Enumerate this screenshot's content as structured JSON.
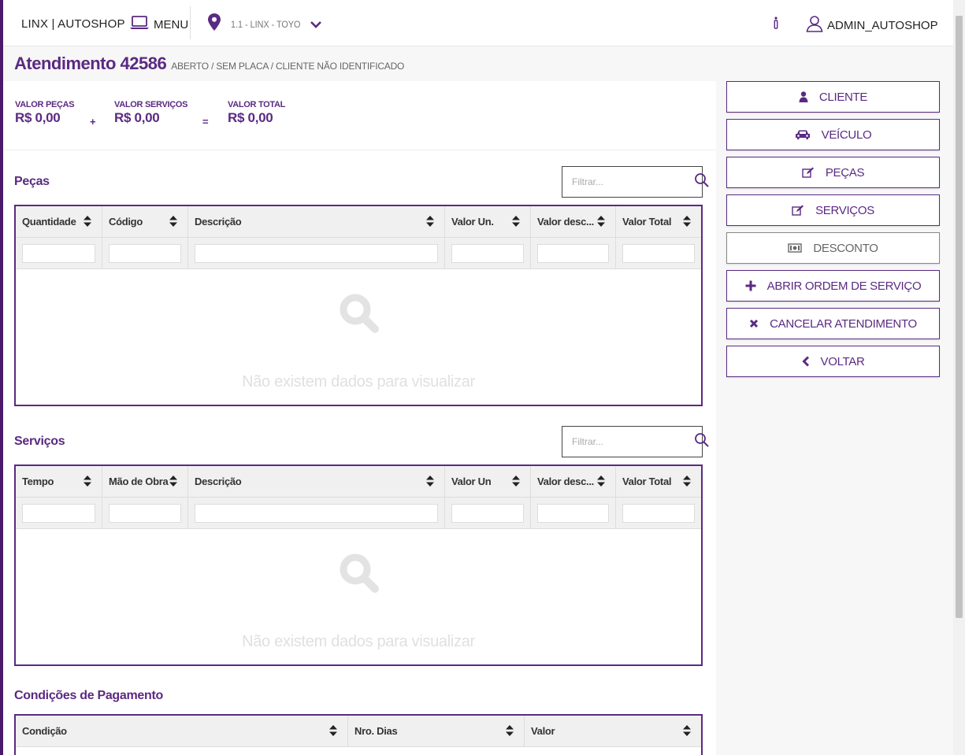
{
  "topbar": {
    "brand": "LINX | AUTOSHOP",
    "menu_label": "MENU",
    "location": "1.1 - LINX - TOYO",
    "user": "ADMIN_AUTOSHOP"
  },
  "header": {
    "title": "Atendimento 42586",
    "subtitle": "ABERTO / SEM PLACA / CLIENTE NÃO IDENTIFICADO"
  },
  "totals": {
    "parts_label": "VALOR PEÇAS",
    "parts_value": "R$ 0,00",
    "services_label": "VALOR SERVIÇOS",
    "services_value": "R$ 0,00",
    "total_label": "VALOR TOTAL",
    "total_value": "R$ 0,00",
    "plus": "+",
    "equals": "="
  },
  "pecas": {
    "title": "Peças",
    "filter_placeholder": "Filtrar...",
    "columns": [
      "Quantidade",
      "Código",
      "Descrição",
      "Valor Un.",
      "Valor desc...",
      "Valor Total"
    ],
    "empty_message": "Não existem dados para visualizar"
  },
  "servicos": {
    "title": "Serviços",
    "filter_placeholder": "Filtrar...",
    "columns": [
      "Tempo",
      "Mão de Obra",
      "Descrição",
      "Valor Un",
      "Valor desc...",
      "Valor Total"
    ],
    "empty_message": "Não existem dados para visualizar"
  },
  "pagamento": {
    "title": "Condições de Pagamento",
    "columns": [
      "Condição",
      "Nro. Dias",
      "Valor"
    ]
  },
  "actions": {
    "cliente": "CLIENTE",
    "veiculo": "VEÍCULO",
    "pecas": "PEÇAS",
    "servicos": "SERVIÇOS",
    "desconto": "DESCONTO",
    "abrir_os": "ABRIR ORDEM DE SERVIÇO",
    "cancelar": "CANCELAR ATENDIMENTO",
    "voltar": "VOLTAR"
  },
  "colors": {
    "accent": "#5a2a82",
    "stripe": "#4b1a6b"
  }
}
